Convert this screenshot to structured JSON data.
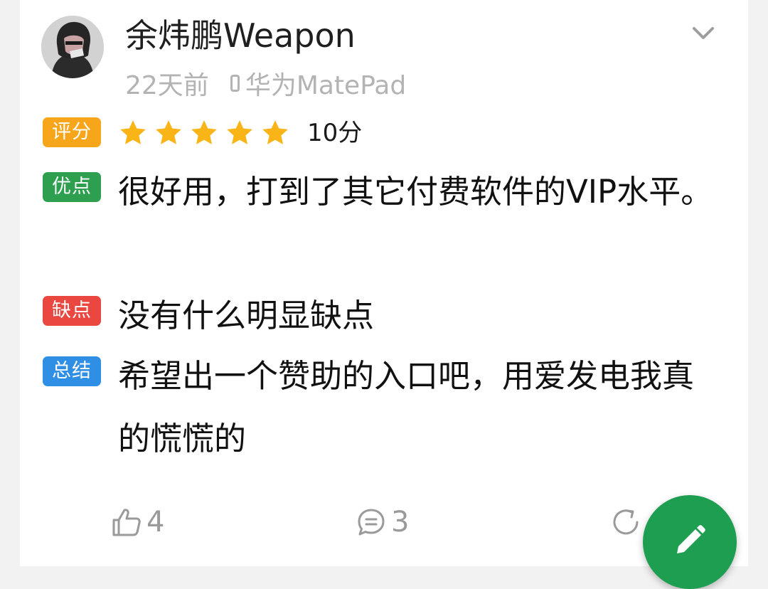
{
  "review": {
    "username": "余炜鹏Weapon",
    "time_ago": "22天前",
    "device": "华为MatePad",
    "rating_tag": "评分",
    "rating_stars": 5,
    "rating_max": 5,
    "score_text": "10分",
    "pros_tag": "优点",
    "pros_text": "很好用，打到了其它付费软件的VIP水平。",
    "cons_tag": "缺点",
    "cons_text": "没有什么明显缺点",
    "summary_tag": "总结",
    "summary_text": "希望出一个赞助的入口吧，用爱发电我真的慌慌的"
  },
  "actions": {
    "likes": "4",
    "comments": "3"
  },
  "icons": {
    "expand": "chevron-down-icon",
    "device": "phone-icon",
    "like": "thumbs-up-icon",
    "comment": "comment-icon",
    "share": "share-icon",
    "fab": "edit-pencil-icon"
  },
  "colors": {
    "rating_tag": "#f7a61c",
    "pros_tag": "#2e9e4f",
    "cons_tag": "#e9473f",
    "summary_tag": "#2f8fe5",
    "star": "#f9b417",
    "fab": "#1e9e50"
  }
}
